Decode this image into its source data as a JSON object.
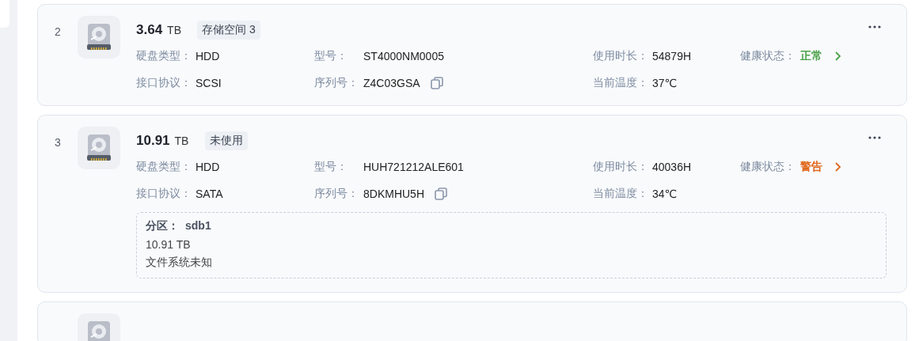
{
  "disks": [
    {
      "index": "2",
      "size": "3.64",
      "unit": "TB",
      "tag": "存储空间 3",
      "fields": [
        {
          "kind": "text",
          "label": "硬盘类型：",
          "value": "HDD"
        },
        {
          "kind": "text",
          "label": "型号：",
          "value": "ST4000NM0005"
        },
        {
          "kind": "text",
          "label": "使用时长：",
          "value": "54879H"
        },
        {
          "kind": "health",
          "label": "健康状态：",
          "value": "正常",
          "color": "#4ca34a"
        },
        {
          "kind": "text",
          "label": "接口协议：",
          "value": "SCSI"
        },
        {
          "kind": "copy",
          "label": "序列号：",
          "value": "Z4C03GSA"
        },
        {
          "kind": "text",
          "label": "当前温度：",
          "value": "37℃"
        }
      ]
    },
    {
      "index": "3",
      "size": "10.91",
      "unit": "TB",
      "tag": "未使用",
      "fields": [
        {
          "kind": "text",
          "label": "硬盘类型：",
          "value": "HDD"
        },
        {
          "kind": "text",
          "label": "型号：",
          "value": "HUH721212ALE601"
        },
        {
          "kind": "text",
          "label": "使用时长：",
          "value": "40036H"
        },
        {
          "kind": "health",
          "label": "健康状态：",
          "value": "警告",
          "color": "#e0681e"
        },
        {
          "kind": "text",
          "label": "接口协议：",
          "value": "SATA"
        },
        {
          "kind": "copy",
          "label": "序列号：",
          "value": "8DKMHU5H"
        },
        {
          "kind": "text",
          "label": "当前温度：",
          "value": "34℃"
        }
      ],
      "partition": {
        "label": "分区：",
        "name": "sdb1",
        "size": "10.91 TB",
        "filesystem": "文件系统未知"
      }
    },
    {
      "cut_off": true
    }
  ]
}
